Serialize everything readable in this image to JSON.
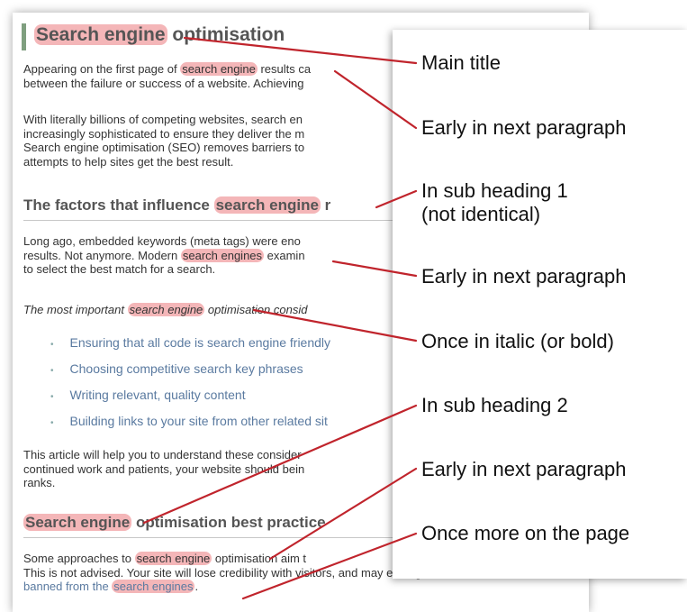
{
  "article": {
    "title_keyword": "Search engine",
    "title_rest": " optimisation",
    "p1_line1_pre": "Appearing on the first page of ",
    "p1_line1_kw": "search engine",
    "p1_line1_post": " results ca",
    "p1_line2": "between the failure or success of a website. Achieving",
    "p2_line1": "With literally billions of competing websites, search en",
    "p2_line2": "increasingly sophisticated to ensure they deliver the m",
    "p2_line3": "Search engine optimisation (SEO) removes barriers to",
    "p2_line4": "attempts to help sites get the best result.",
    "sub1_pre": "The factors that influence ",
    "sub1_kw": "search engine",
    "sub1_post": " r",
    "p3_line1": "Long ago, embedded keywords (meta tags) were eno",
    "p3_line2_pre": "results. Not anymore. Modern ",
    "p3_line2_kw": "search engines",
    "p3_line2_post": " examin",
    "p3_line3": "to select the best match for a search.",
    "p4_pre": "The most important ",
    "p4_kw": "search engine",
    "p4_post": " optimisation consid",
    "bullets": [
      "Ensuring that all code is search engine friendly",
      "Choosing competitive search key phrases",
      "Writing relevant, quality content",
      "Building links to your site from other related sit"
    ],
    "p5_line1": "This article will help you to understand these consider",
    "p5_line2": "continued work and patients, your website should bein",
    "p5_line3": "ranks.",
    "sub2_kw": "Search engine",
    "sub2_post": " optimisation best practice",
    "p6_line1_pre": "Some approaches to ",
    "p6_line1_kw": "search engine",
    "p6_line1_post": " optimisation aim t",
    "p6_line2": "This is not advised. Your site will lose credibility with visitors, and may even get",
    "p6_line3_pre": "banned from the ",
    "p6_line3_kw": "search engines",
    "p6_line3_post": "."
  },
  "callouts": [
    "Main title",
    "Early in next paragraph",
    "In sub heading 1\n(not identical)",
    "Early in next paragraph",
    "Once in italic (or bold)",
    "In sub heading 2",
    "Early in next paragraph",
    "Once more on the page"
  ],
  "colors": {
    "highlight": "#f4b6b8",
    "connector": "#c0242c",
    "link_text": "#5a7aa0",
    "title_bar": "#7f9f7f"
  }
}
